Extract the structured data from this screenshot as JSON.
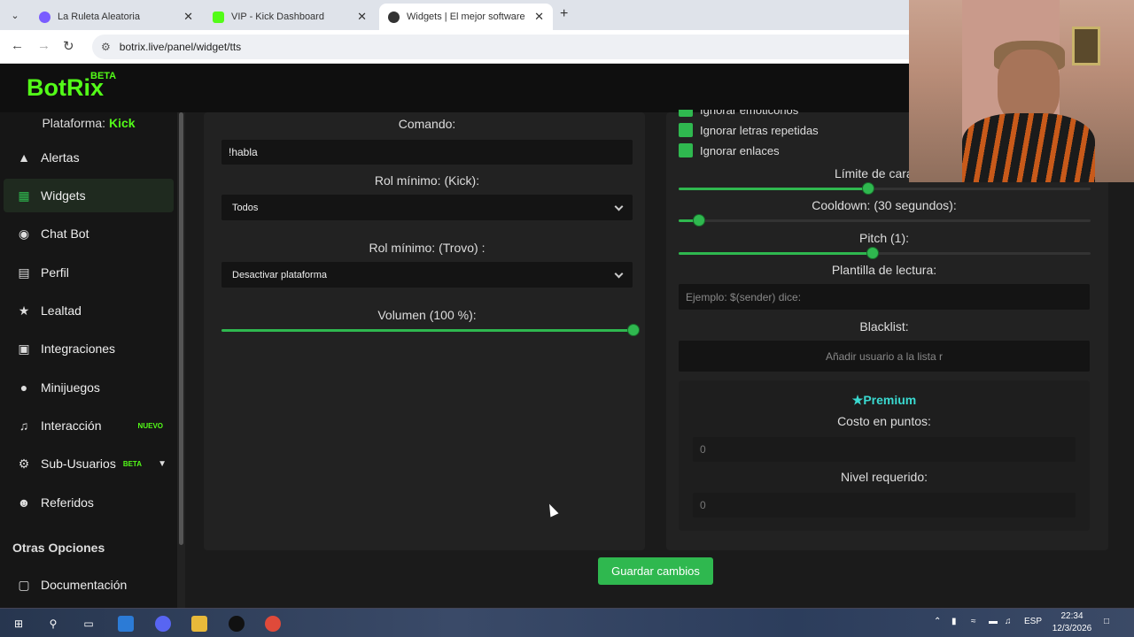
{
  "browser": {
    "tabs": [
      {
        "title": "La Ruleta Aleatoria",
        "favicon_color": "#7a5cff"
      },
      {
        "title": "VIP - Kick Dashboard",
        "favicon_color": "#53fc18"
      },
      {
        "title": "Widgets | El mejor software par",
        "favicon_color": "#333333"
      }
    ],
    "url": "botrix.live/panel/widget/tts"
  },
  "app": {
    "logo": "BotRix",
    "logo_badge": "BETA",
    "accent": "#2fb84f",
    "brand_green": "#53fc18"
  },
  "sidebar": {
    "platform_label": "Plataforma:",
    "platform_value": "Kick",
    "items": [
      {
        "label": "Alertas",
        "icon": "warning-icon"
      },
      {
        "label": "Widgets",
        "icon": "grid-icon",
        "active": true
      },
      {
        "label": "Chat Bot",
        "icon": "robot-icon"
      },
      {
        "label": "Perfil",
        "icon": "id-card-icon"
      },
      {
        "label": "Lealtad",
        "icon": "trophy-icon"
      },
      {
        "label": "Integraciones",
        "icon": "plug-icon"
      },
      {
        "label": "Minijuegos",
        "icon": "gamepad-icon"
      },
      {
        "label": "Interacción",
        "icon": "music-icon",
        "badge": "NUEVO"
      },
      {
        "label": "Sub-Usuarios",
        "icon": "users-cog-icon",
        "badge": "BETA"
      },
      {
        "label": "Referidos",
        "icon": "users-icon"
      }
    ],
    "section_title": "Otras Opciones",
    "extra_items": [
      {
        "label": "Documentación",
        "icon": "book-icon"
      }
    ]
  },
  "left_panel": {
    "command_label": "Comando:",
    "command_value": "!habla",
    "kick_role_label": "Rol mínimo: (Kick):",
    "kick_role_value": "Todos",
    "trovo_role_label": "Rol mínimo: (Trovo) :",
    "trovo_role_value": "Desactivar plataforma",
    "volume_label": "Volumen (100 %):",
    "volume_percent": 100
  },
  "right_panel": {
    "checkbox_partial": "Ignorar emoticonos",
    "checkboxes": [
      "Ignorar letras repetidas",
      "Ignorar enlaces"
    ],
    "char_limit_label": "Límite de caracter",
    "char_limit_fraction": 0.46,
    "cooldown_label": "Cooldown: (30 segundos):",
    "cooldown_fraction": 0.05,
    "pitch_label": "Pitch (1):",
    "pitch_fraction": 0.47,
    "template_label": "Plantilla de lectura:",
    "template_placeholder": "Ejemplo: $(sender) dice:",
    "blacklist_label": "Blacklist:",
    "blacklist_placeholder": "Añadir usuario a la lista r",
    "premium_title": "Premium",
    "cost_label": "Costo en puntos:",
    "cost_value": "0",
    "level_label": "Nivel requerido:",
    "level_value": "0"
  },
  "actions": {
    "save_label": "Guardar cambios"
  },
  "taskbar": {
    "language": "ESP",
    "time": "22:34",
    "date": "12/3/2026"
  }
}
